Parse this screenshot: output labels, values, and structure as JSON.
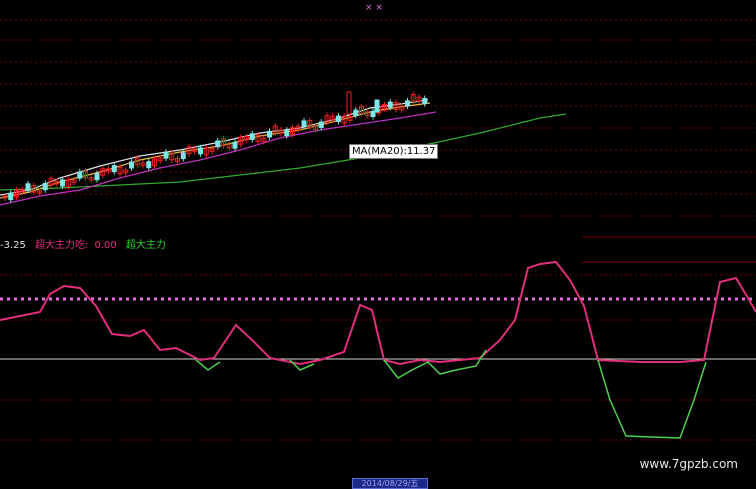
{
  "colors": {
    "background": "#000000",
    "grid": "#7a0000",
    "candle_up": "#e82020",
    "candle_down": "#7fe6e6",
    "ma_short": "#e0e0e0",
    "ma_mid": "#e0c040",
    "ma_long": "#c030c0",
    "ma20": "#2faa2f",
    "indicator_pos": "#e0307a",
    "indicator_neg": "#4fd04f",
    "threshold": "#e070e0",
    "zero_line": "#d0d0d0",
    "legend_value": "#e0307a",
    "legend_green": "#2fd02f"
  },
  "tooltip": {
    "text": "MA(MA20):11.37"
  },
  "indicator_legend": {
    "first_value": "-3.25",
    "item2_label": "超大主力吃:",
    "item2_value": "0.00",
    "item3_label": "超大主力"
  },
  "date_label": "2014/08/29/五",
  "watermark": "www.7gpzb.com",
  "chart_data": [
    {
      "type": "candlestick",
      "title": "",
      "series": [
        {
          "name": "MA(MA20)",
          "points": [
            [
              0,
              190
            ],
            [
              60,
              188
            ],
            [
              120,
              185
            ],
            [
              180,
              182
            ],
            [
              240,
              175
            ],
            [
              300,
              168
            ],
            [
              360,
              158
            ],
            [
              420,
              146
            ],
            [
              480,
              133
            ],
            [
              540,
              118
            ],
            [
              566,
              114
            ]
          ]
        }
      ],
      "annotation": "MA(MA20):11.37"
    },
    {
      "type": "line",
      "title": "",
      "legend": [
        "-3.25",
        "超大主力吃: 0.00",
        "超大主力"
      ]
    }
  ]
}
